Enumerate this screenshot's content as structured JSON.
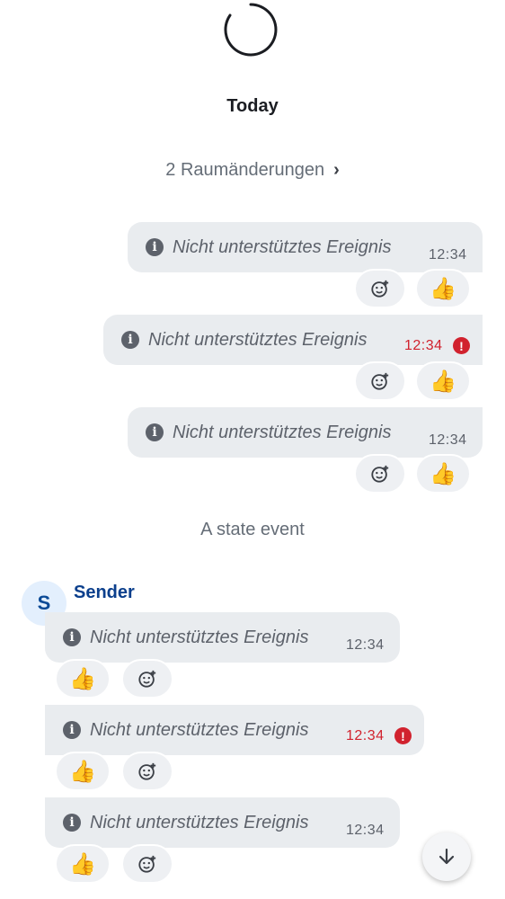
{
  "timeline": {
    "date_separator": "Today",
    "room_changes": "2 Raumänderungen",
    "state_event": "A state event"
  },
  "sender": {
    "name": "Sender",
    "avatar_initial": "S"
  },
  "messages": [
    {
      "text": "Nicht unterstütztes Ereignis",
      "time": "12:34",
      "reaction": "👍",
      "error": false
    },
    {
      "text": "Nicht unterstütztes Ereignis",
      "time": "12:34",
      "reaction": "👍",
      "error": true
    },
    {
      "text": "Nicht unterstütztes Ereignis",
      "time": "12:34",
      "reaction": "👍",
      "error": false
    },
    {
      "text": "Nicht unterstütztes Ereignis",
      "time": "12:34",
      "reaction": "👍",
      "error": false
    },
    {
      "text": "Nicht unterstütztes Ereignis",
      "time": "12:34",
      "reaction": "👍",
      "error": true
    },
    {
      "text": "Nicht unterstütztes Ereignis",
      "time": "12:34",
      "reaction": "👍",
      "error": false
    }
  ],
  "icons": {
    "info": "info-icon",
    "error": "error-icon",
    "add_reaction": "add-reaction-icon",
    "chevron": "chevron-right-icon",
    "scroll": "arrow-down-icon"
  },
  "colors": {
    "error": "#d1222e",
    "sender": "#0b3f8c",
    "bubble": "#e9ecef"
  }
}
